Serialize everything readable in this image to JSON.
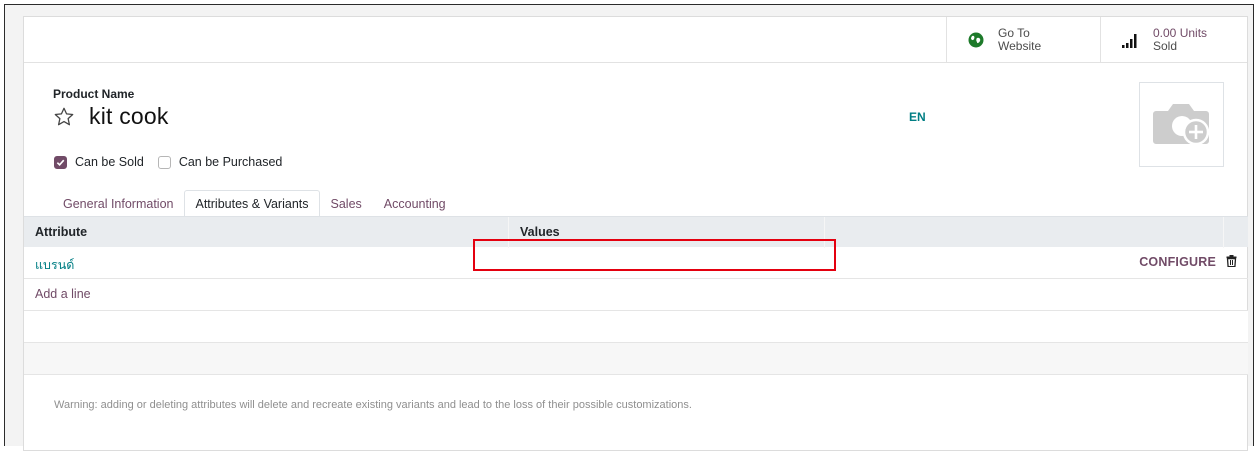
{
  "stat_buttons": {
    "website": {
      "line1": "Go To",
      "line2": "Website",
      "icon": "globe-icon"
    },
    "sold": {
      "value": "0.00 Units",
      "label": "Sold",
      "icon": "bar-chart-icon"
    }
  },
  "product": {
    "name_label": "Product Name",
    "name": "kit cook",
    "language": "EN",
    "image_placeholder_icon": "camera-plus-icon"
  },
  "checkboxes": [
    {
      "label": "Can be Sold",
      "checked": true
    },
    {
      "label": "Can be Purchased",
      "checked": false
    }
  ],
  "tabs": [
    {
      "label": "General Information",
      "active": false
    },
    {
      "label": "Attributes & Variants",
      "active": true
    },
    {
      "label": "Sales",
      "active": false
    },
    {
      "label": "Accounting",
      "active": false
    }
  ],
  "table": {
    "columns": [
      "Attribute",
      "Values",
      ""
    ],
    "rows": [
      {
        "attribute": "แบรนด์",
        "values": "",
        "action": "CONFIGURE"
      }
    ],
    "add_line": "Add a line"
  },
  "warning": "Warning: adding or deleting attributes will delete and recreate existing variants and lead to the loss of their possible customizations.",
  "colors": {
    "accent": "#714b67",
    "teal": "#017e84",
    "highlight": "#e4000f"
  }
}
